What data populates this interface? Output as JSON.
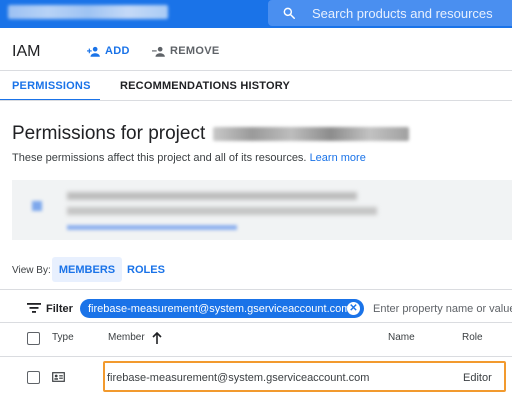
{
  "topbar": {
    "search_placeholder": "Search products and resources",
    "search_icon": "search-icon",
    "accent": "#1a73e8"
  },
  "header": {
    "title": "IAM",
    "add_label": "ADD",
    "remove_label": "REMOVE",
    "add_icon": "person-add-icon",
    "remove_icon": "person-remove-icon"
  },
  "tabs": [
    {
      "label": "PERMISSIONS",
      "active": true
    },
    {
      "label": "RECOMMENDATIONS HISTORY",
      "active": false
    }
  ],
  "permissions": {
    "heading_prefix": "Permissions for project",
    "description": "These permissions affect this project and all of its resources.",
    "learn_more": "Learn more"
  },
  "view_by": {
    "label": "View By:",
    "options": [
      "MEMBERS",
      "ROLES"
    ],
    "selected": "MEMBERS"
  },
  "filter": {
    "label": "Filter",
    "chip": "firebase-measurement@system.gserviceaccount.com",
    "placeholder": "Enter property name or value"
  },
  "table": {
    "columns": [
      "Type",
      "Member",
      "Name",
      "Role"
    ],
    "sort_column": "Member",
    "rows": [
      {
        "type_icon": "service-account-icon",
        "member": "firebase-measurement@system.gserviceaccount.com",
        "name": "",
        "role": "Editor"
      }
    ]
  },
  "highlight_color": "#f29a2e"
}
